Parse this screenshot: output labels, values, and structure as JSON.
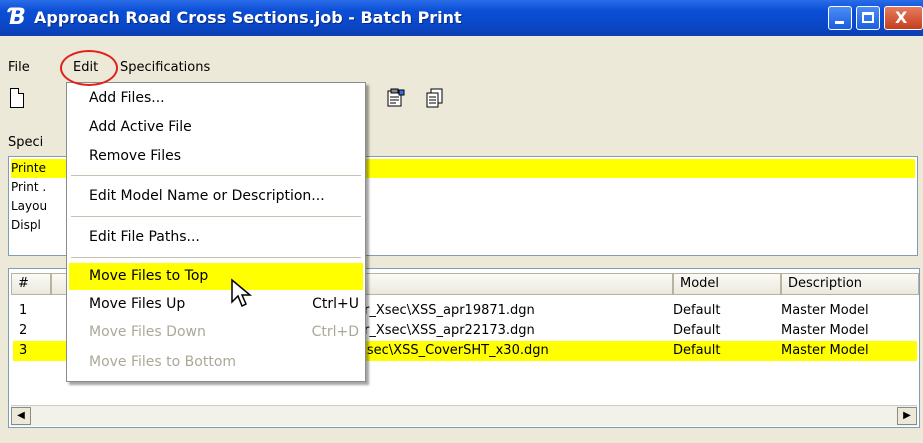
{
  "window": {
    "title": "Approach Road Cross Sections.job - Batch Print"
  },
  "menubar": {
    "file": "File",
    "edit": "Edit",
    "specifications": "Specifications"
  },
  "spec_panel": {
    "label": "Speci",
    "rows": [
      "Printe",
      "Print .",
      "Layou",
      "Displ"
    ]
  },
  "file_table": {
    "headers": [
      "#",
      "",
      "Model",
      "Description"
    ],
    "rows": [
      {
        "num": "1",
        "file": "Minor_Xsec\\XSS_apr19871.dgn",
        "model": "Default",
        "desc": "Master Model"
      },
      {
        "num": "2",
        "file": "Minor_Xsec\\XSS_apr22173.dgn",
        "model": "Default",
        "desc": "Master Model"
      },
      {
        "num": "3",
        "file": "ML_Xsec\\XSS_CoverSHT_x30.dgn",
        "model": "Default",
        "desc": "Master Model"
      }
    ]
  },
  "edit_menu": {
    "items": [
      {
        "label": "Add Files...",
        "shortcut": "",
        "enabled": true
      },
      {
        "label": "Add Active File",
        "shortcut": "",
        "enabled": true
      },
      {
        "label": "Remove Files",
        "shortcut": "",
        "enabled": true
      },
      {
        "label": "Edit Model Name or Description...",
        "shortcut": "",
        "enabled": true
      },
      {
        "label": "Edit File Paths...",
        "shortcut": "",
        "enabled": true
      },
      {
        "label": "Move Files to Top",
        "shortcut": "",
        "enabled": true,
        "highlighted": true
      },
      {
        "label": "Move Files Up",
        "shortcut": "Ctrl+U",
        "enabled": true
      },
      {
        "label": "Move Files Down",
        "shortcut": "Ctrl+D",
        "enabled": false
      },
      {
        "label": "Move Files to Bottom",
        "shortcut": "",
        "enabled": false
      }
    ]
  },
  "colors": {
    "highlight": "#ffff00",
    "titlebar": "#0b4fd6",
    "annotation_circle": "#e0201a"
  },
  "icons": {
    "app": "batch-print-app-icon",
    "new": "new-document-icon",
    "properties": "properties-icon",
    "copy": "copy-pages-icon",
    "cursor": "mouse-pointer-icon"
  }
}
